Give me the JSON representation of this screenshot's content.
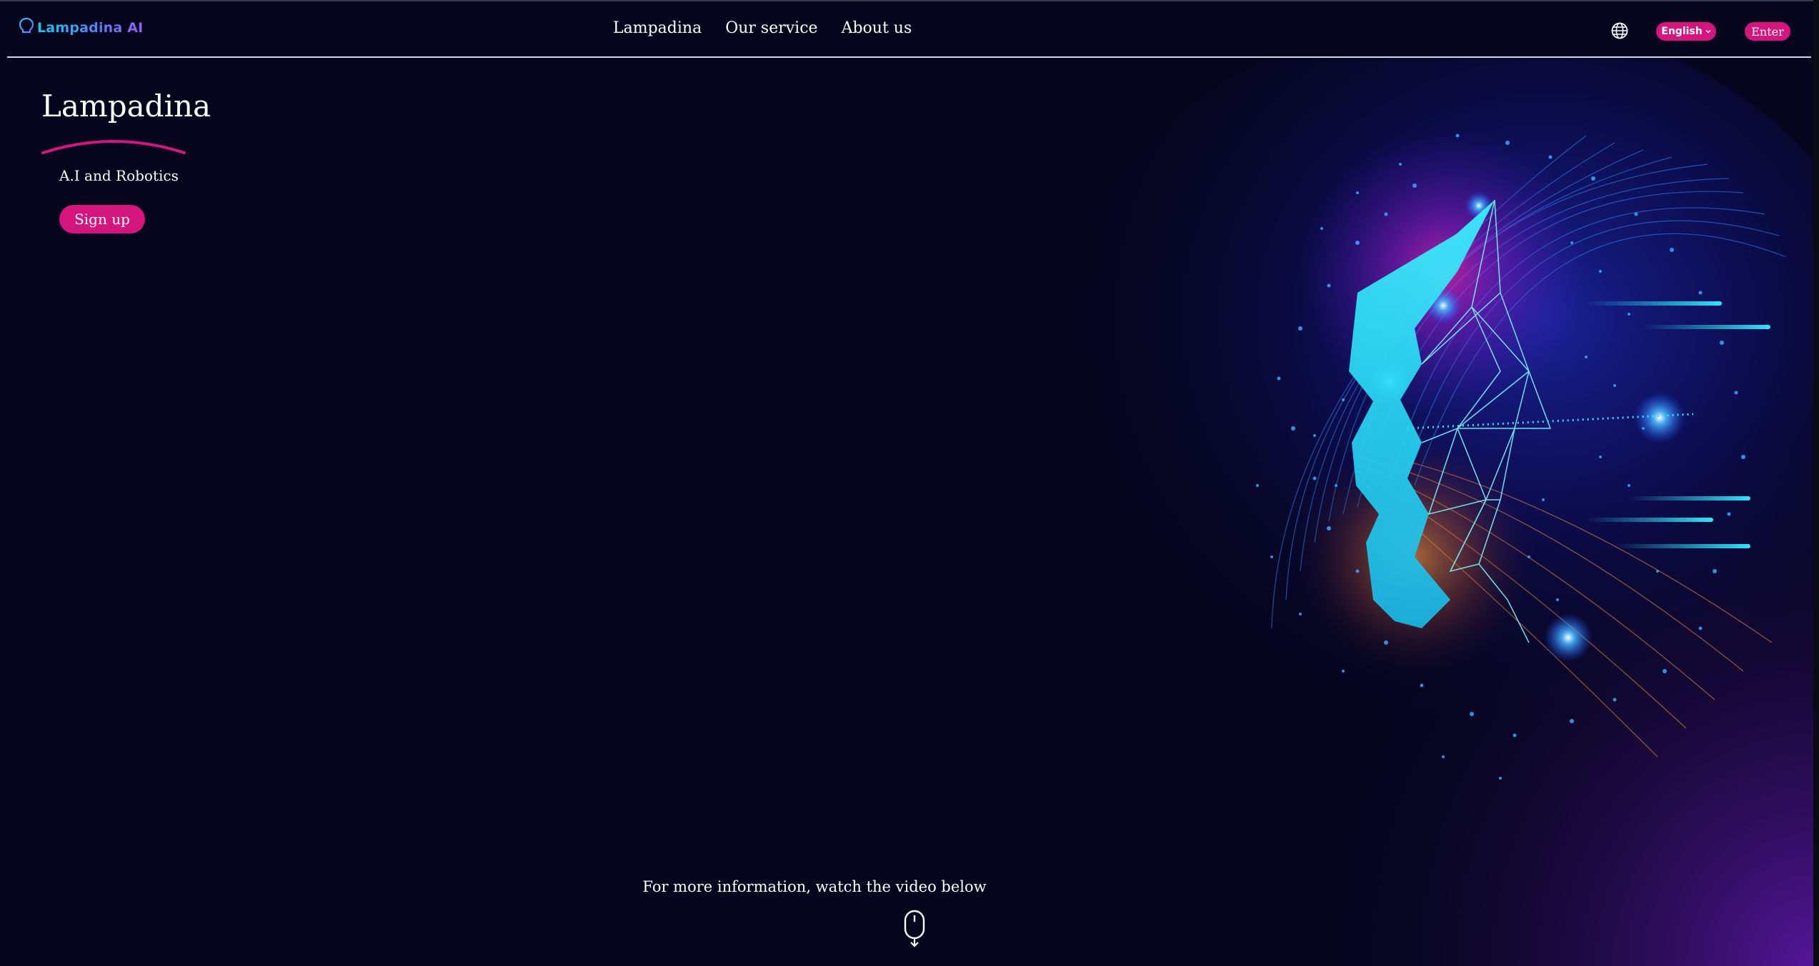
{
  "header": {
    "logo_text": "Lampadina AI",
    "nav": [
      {
        "label": "Lampadina"
      },
      {
        "label": "Our service"
      },
      {
        "label": "About us"
      }
    ],
    "language_button": "English",
    "enter_button": "Enter",
    "icons": [
      "lightbulb-icon",
      "globe-icon",
      "chevron-down-icon"
    ]
  },
  "hero": {
    "title": "Lampadina",
    "subtitle": "A.I and Robotics",
    "signup_button": "Sign up",
    "info_text": "For more information, watch the video below"
  },
  "colors": {
    "background": "#05051e",
    "accent": "#d4157e",
    "text": "#ffffff",
    "art_cyan": "#2ee6ff",
    "art_blue": "#1a4dff",
    "art_magenta": "#ff2aa8",
    "art_orange": "#ff8a2a"
  }
}
